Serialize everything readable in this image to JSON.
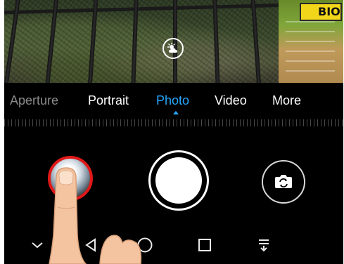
{
  "viewfinder": {
    "sign_text": "BIO",
    "scene_icon": "sun-cloud-icon"
  },
  "modes": {
    "items": [
      {
        "label": "Aperture",
        "state": "dim"
      },
      {
        "label": "Portrait",
        "state": "normal"
      },
      {
        "label": "Photo",
        "state": "active"
      },
      {
        "label": "Video",
        "state": "normal"
      },
      {
        "label": "More",
        "state": "normal"
      }
    ],
    "active_color": "#26a8ff"
  },
  "controls": {
    "gallery_icon": "gallery-thumbnail",
    "shutter_icon": "shutter-button",
    "switch_icon": "switch-camera-icon",
    "highlight_color": "#e01818"
  },
  "nav": {
    "items": [
      "chevron-down-icon",
      "back-triangle-icon",
      "home-circle-icon",
      "recents-square-icon",
      "notification-pull-icon"
    ]
  }
}
